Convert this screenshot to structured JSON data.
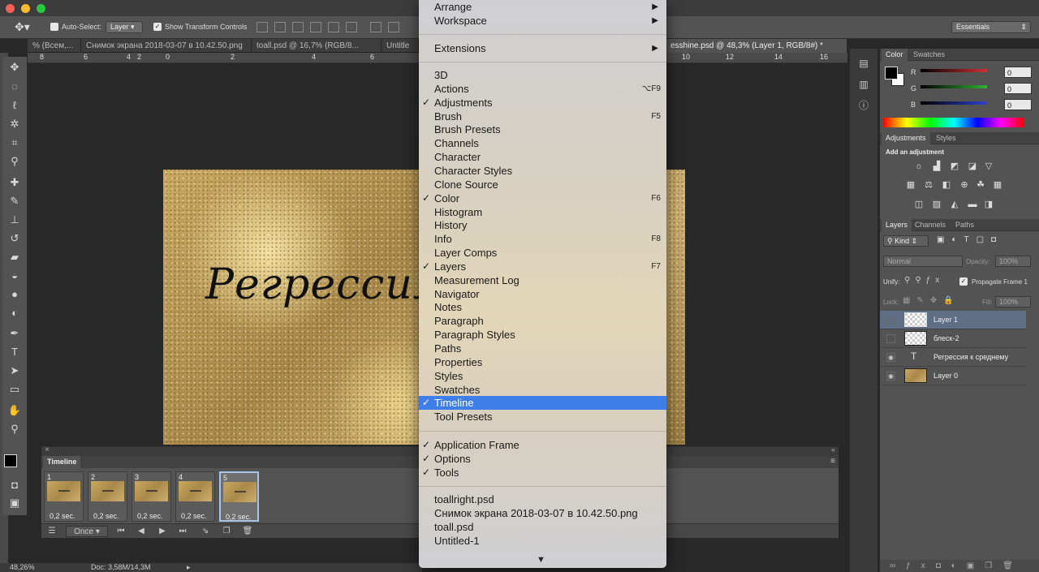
{
  "options_bar": {
    "auto_select_label": "Auto-Select:",
    "auto_select_value": "Layer",
    "show_transform_label": "Show Transform Controls",
    "workspace_value": "Essentials"
  },
  "doc_tabs": [
    {
      "label": "% (Всем,..."
    },
    {
      "label": "Снимок экрана 2018-03-07 в 10.42.50.png"
    },
    {
      "label": "toall.psd @ 16,7% (RGB/8..."
    },
    {
      "label": "Untitle"
    },
    {
      "label": "esshine.psd @ 48,3% (Layer 1, RGB/8#) *"
    }
  ],
  "ruler": {
    "left_numbers": [
      "8",
      "6",
      "4",
      "2",
      "0",
      "2",
      "4",
      "6"
    ],
    "right_numbers": [
      "10",
      "12",
      "14",
      "16"
    ]
  },
  "canvas": {
    "text": "Регрессия"
  },
  "timeline": {
    "tab_label": "Timeline",
    "frames": [
      {
        "num": "1",
        "delay": "0,2 sec."
      },
      {
        "num": "2",
        "delay": "0,2 sec."
      },
      {
        "num": "3",
        "delay": "0,2 sec."
      },
      {
        "num": "4",
        "delay": "0,2 sec."
      },
      {
        "num": "5",
        "delay": "0,2 sec."
      }
    ],
    "loop_value": "Once"
  },
  "status": {
    "zoom": "48,26%",
    "doc": "Doc: 3,58M/14,3M"
  },
  "color_panel": {
    "tabs": [
      "Color",
      "Swatches"
    ],
    "channels": [
      {
        "label": "R",
        "value": "0",
        "color": "#d03030"
      },
      {
        "label": "G",
        "value": "0",
        "color": "#30b030"
      },
      {
        "label": "B",
        "value": "0",
        "color": "#3040d0"
      }
    ]
  },
  "adjustments_panel": {
    "tabs": [
      "Adjustments",
      "Styles"
    ],
    "hint": "Add an adjustment"
  },
  "layers_panel": {
    "tabs": [
      "Layers",
      "Channels",
      "Paths"
    ],
    "filter_label": "Kind",
    "blend_mode": "Normal",
    "opacity_label": "Opacity:",
    "opacity_value": "100%",
    "unify_label": "Unify:",
    "propagate_label": "Propagate Frame 1",
    "lock_label": "Lock:",
    "fill_label": "Fill:",
    "fill_value": "100%",
    "layers": [
      {
        "name": "Layer 1",
        "visible": false,
        "selected": true,
        "type": "pixel"
      },
      {
        "name": "блеск-2",
        "visible": false,
        "selected": false,
        "type": "pixel"
      },
      {
        "name": "Регрессия к среднему",
        "visible": true,
        "selected": false,
        "type": "text"
      },
      {
        "name": "Layer 0",
        "visible": true,
        "selected": false,
        "type": "gold"
      }
    ]
  },
  "window_menu": {
    "group1": [
      {
        "label": "Arrange",
        "submenu": true
      },
      {
        "label": "Workspace",
        "submenu": true
      }
    ],
    "group2": [
      {
        "label": "Extensions",
        "submenu": true
      }
    ],
    "group3": [
      {
        "label": "3D",
        "checked": false,
        "shortcut": ""
      },
      {
        "label": "Actions",
        "checked": false,
        "shortcut": "⌥F9"
      },
      {
        "label": "Adjustments",
        "checked": true,
        "shortcut": ""
      },
      {
        "label": "Brush",
        "checked": false,
        "shortcut": "F5"
      },
      {
        "label": "Brush Presets",
        "checked": false,
        "shortcut": ""
      },
      {
        "label": "Channels",
        "checked": false,
        "shortcut": ""
      },
      {
        "label": "Character",
        "checked": false,
        "shortcut": ""
      },
      {
        "label": "Character Styles",
        "checked": false,
        "shortcut": ""
      },
      {
        "label": "Clone Source",
        "checked": false,
        "shortcut": ""
      },
      {
        "label": "Color",
        "checked": true,
        "shortcut": "F6"
      },
      {
        "label": "Histogram",
        "checked": false,
        "shortcut": ""
      },
      {
        "label": "History",
        "checked": false,
        "shortcut": ""
      },
      {
        "label": "Info",
        "checked": false,
        "shortcut": "F8"
      },
      {
        "label": "Layer Comps",
        "checked": false,
        "shortcut": ""
      },
      {
        "label": "Layers",
        "checked": true,
        "shortcut": "F7"
      },
      {
        "label": "Measurement Log",
        "checked": false,
        "shortcut": ""
      },
      {
        "label": "Navigator",
        "checked": false,
        "shortcut": ""
      },
      {
        "label": "Notes",
        "checked": false,
        "shortcut": ""
      },
      {
        "label": "Paragraph",
        "checked": false,
        "shortcut": ""
      },
      {
        "label": "Paragraph Styles",
        "checked": false,
        "shortcut": ""
      },
      {
        "label": "Paths",
        "checked": false,
        "shortcut": ""
      },
      {
        "label": "Properties",
        "checked": false,
        "shortcut": ""
      },
      {
        "label": "Styles",
        "checked": false,
        "shortcut": ""
      },
      {
        "label": "Swatches",
        "checked": false,
        "shortcut": ""
      },
      {
        "label": "Timeline",
        "checked": true,
        "shortcut": "",
        "highlighted": true
      },
      {
        "label": "Tool Presets",
        "checked": false,
        "shortcut": ""
      }
    ],
    "group4": [
      {
        "label": "Application Frame",
        "checked": true
      },
      {
        "label": "Options",
        "checked": true
      },
      {
        "label": "Tools",
        "checked": true
      }
    ],
    "group5": [
      {
        "label": "toallright.psd"
      },
      {
        "label": "Снимок экрана 2018-03-07 в 10.42.50.png"
      },
      {
        "label": "toall.psd"
      },
      {
        "label": "Untitled-1"
      }
    ]
  }
}
